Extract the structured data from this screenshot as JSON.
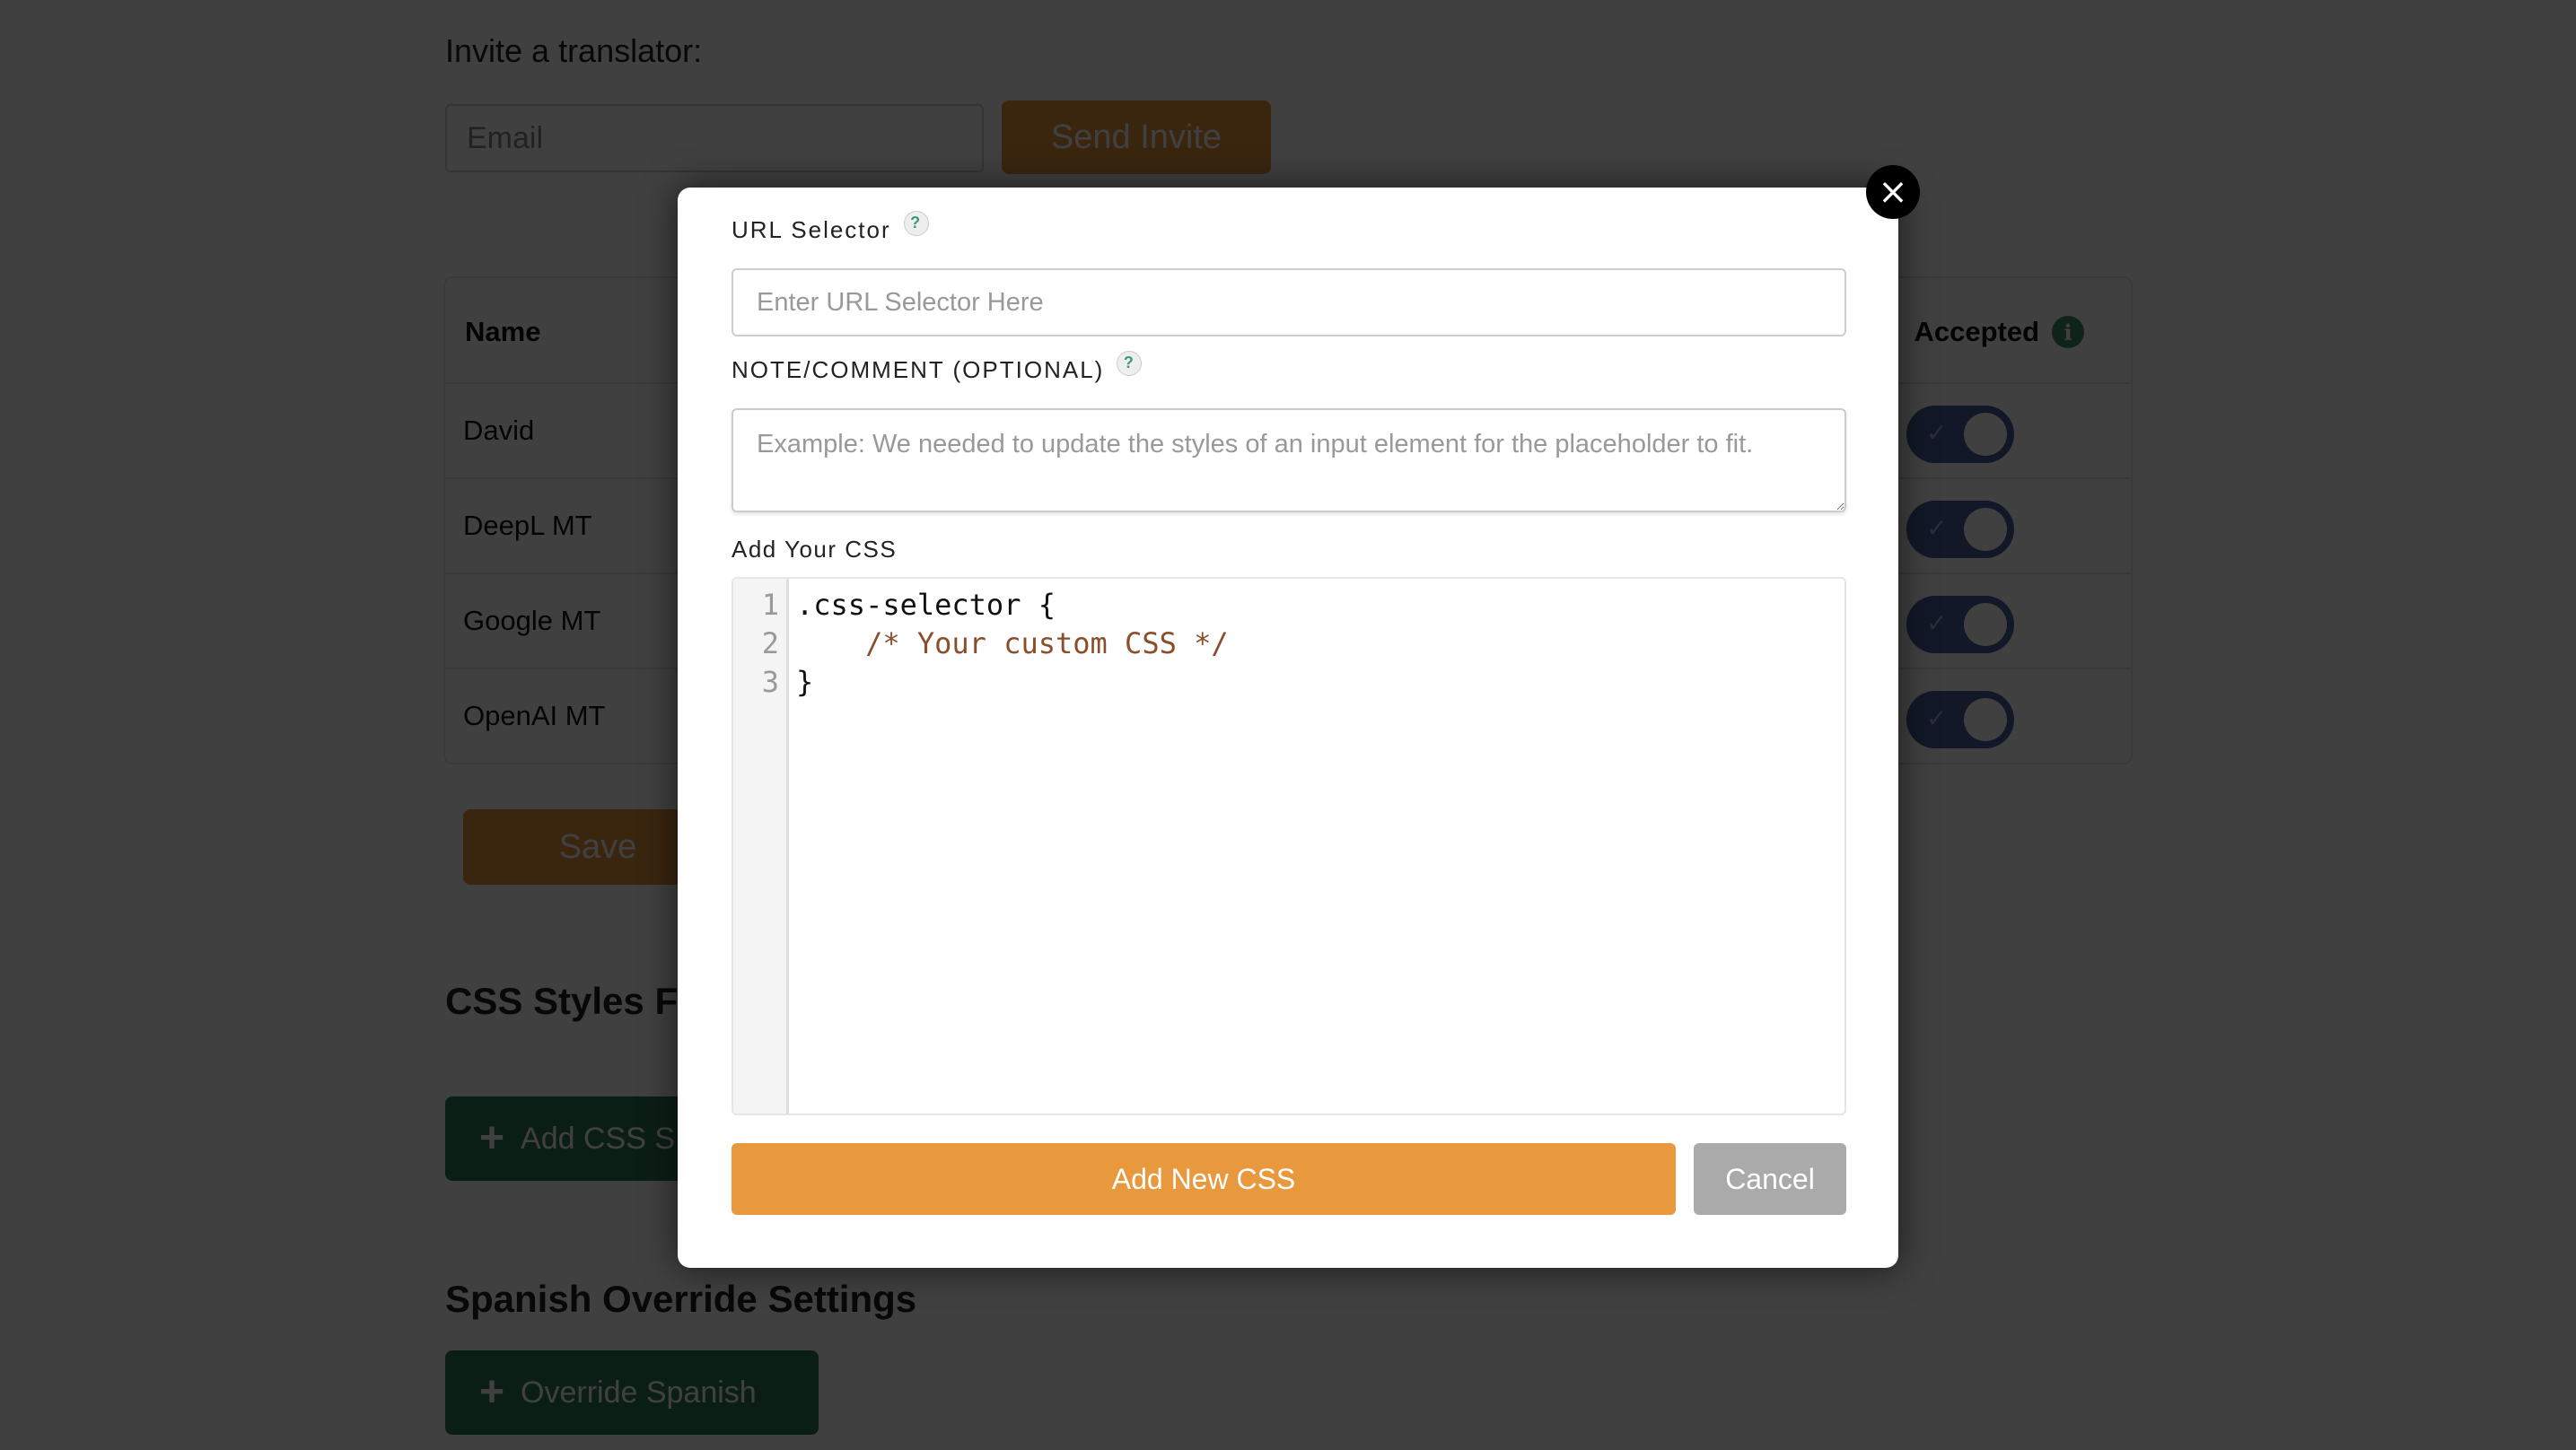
{
  "background": {
    "invite_heading": "Invite a translator:",
    "email_placeholder": "Email",
    "send_invite_label": "Send Invite",
    "table": {
      "columns": {
        "name": "Name",
        "accepted": "Accepted"
      },
      "rows": [
        {
          "name": "David",
          "accepted": true
        },
        {
          "name": "DeepL MT",
          "accepted": true
        },
        {
          "name": "Google MT",
          "accepted": true
        },
        {
          "name": "OpenAI MT",
          "accepted": true
        }
      ]
    },
    "save_label": "Save",
    "css_section_heading": "CSS Styles F",
    "add_css_label": "Add CSS S",
    "spanish_heading": "Spanish Override Settings",
    "override_label": "Override Spanish"
  },
  "modal": {
    "close_glyph": "×",
    "url_selector": {
      "label": "URL Selector",
      "placeholder": "Enter URL Selector Here",
      "value": ""
    },
    "note": {
      "label": "NOTE/COMMENT (OPTIONAL)",
      "placeholder": "Example: We needed to update the styles of an input element for the placeholder to fit.",
      "value": ""
    },
    "css_editor": {
      "label": "Add Your CSS",
      "line_numbers": [
        "1",
        "2",
        "3"
      ],
      "lines": [
        ".css-selector {",
        "    /* Your custom CSS */",
        "}"
      ]
    },
    "add_button_label": "Add New CSS",
    "cancel_button_label": "Cancel",
    "help_glyph": "?"
  },
  "colors": {
    "primary_orange": "#e8983d",
    "secondary_green": "#2d7a5a",
    "cancel_gray": "#aaaaaa",
    "toggle_blue": "#4a5f9a",
    "comment_brown": "#8a4e2b"
  }
}
